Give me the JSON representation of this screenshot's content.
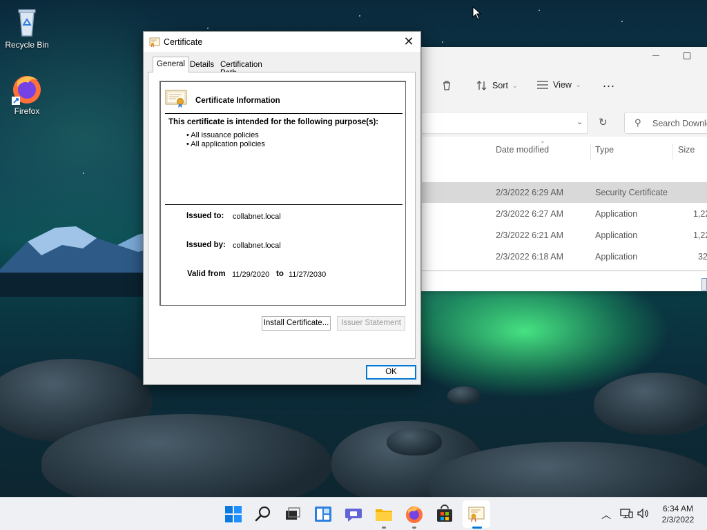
{
  "desktop": {
    "icons": [
      {
        "label": "Recycle Bin"
      },
      {
        "label": "Firefox"
      }
    ]
  },
  "explorer": {
    "toolbar": {
      "sort_label": "Sort",
      "view_label": "View",
      "more_label": "..."
    },
    "search_placeholder": "Search Downlo",
    "columns": [
      "Date modified",
      "Type",
      "Size"
    ],
    "rows": [
      {
        "date": "2/3/2022 6:29 AM",
        "type": "Security Certificate",
        "size": "",
        "selected": true
      },
      {
        "date": "2/3/2022 6:27 AM",
        "type": "Application",
        "size": "1,22"
      },
      {
        "date": "2/3/2022 6:21 AM",
        "type": "Application",
        "size": "1,22"
      },
      {
        "date": "2/3/2022 6:18 AM",
        "type": "Application",
        "size": "32"
      }
    ]
  },
  "dialog": {
    "title": "Certificate",
    "close_label": "✕",
    "tabs": [
      "General",
      "Details",
      "Certification Path"
    ],
    "active_tab": "General",
    "info_heading": "Certificate Information",
    "purpose_heading": "This certificate is intended for the following purpose(s):",
    "purposes": [
      "• All issuance policies",
      "• All application policies"
    ],
    "issued_to_label": "Issued to:",
    "issued_to_value": "collabnet.local",
    "issued_by_label": "Issued by:",
    "issued_by_value": "collabnet.local",
    "valid_from_label": "Valid from",
    "valid_from_value": "11/29/2020",
    "valid_to_label": "to",
    "valid_to_value": "11/27/2030",
    "install_button": "Install Certificate...",
    "issuer_button": "Issuer Statement",
    "ok_button": "OK"
  },
  "taskbar": {
    "time": "6:34 AM",
    "date": "2/3/2022"
  },
  "colors": {
    "accent": "#0078d7",
    "taskbar_bg": "#eef0f3"
  }
}
